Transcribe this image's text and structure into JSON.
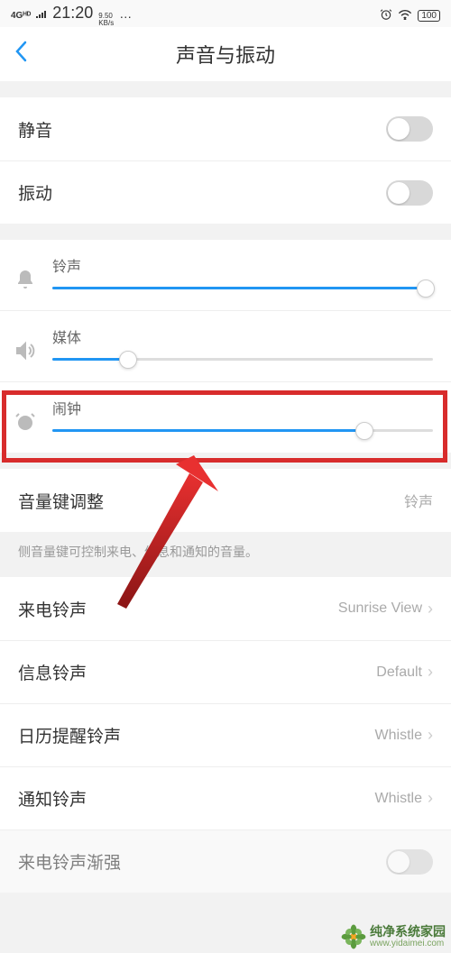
{
  "status_bar": {
    "network": "4Gᴴᴰ",
    "time": "21:20",
    "speed_top": "9.50",
    "speed_bottom": "KB/s",
    "dots": "…",
    "battery": "100"
  },
  "header": {
    "title": "声音与振动"
  },
  "toggles": {
    "silent": {
      "label": "静音",
      "on": false
    },
    "vibrate": {
      "label": "振动",
      "on": false
    }
  },
  "sliders": {
    "ringtone": {
      "label": "铃声",
      "percent": 98
    },
    "media": {
      "label": "媒体",
      "percent": 20
    },
    "alarm": {
      "label": "闹钟",
      "percent": 82
    }
  },
  "volume_key": {
    "label": "音量键调整",
    "value": "铃声",
    "help": "侧音量键可控制来电、信息和通知的音量。"
  },
  "sound_settings": {
    "incoming": {
      "label": "来电铃声",
      "value": "Sunrise View"
    },
    "message": {
      "label": "信息铃声",
      "value": "Default"
    },
    "calendar": {
      "label": "日历提醒铃声",
      "value": "Whistle"
    },
    "notification": {
      "label": "通知铃声",
      "value": "Whistle"
    },
    "ascending": {
      "label": "来电铃声渐强"
    }
  },
  "watermark": {
    "name": "纯净系统家园",
    "url": "www.yidaimei.com"
  }
}
